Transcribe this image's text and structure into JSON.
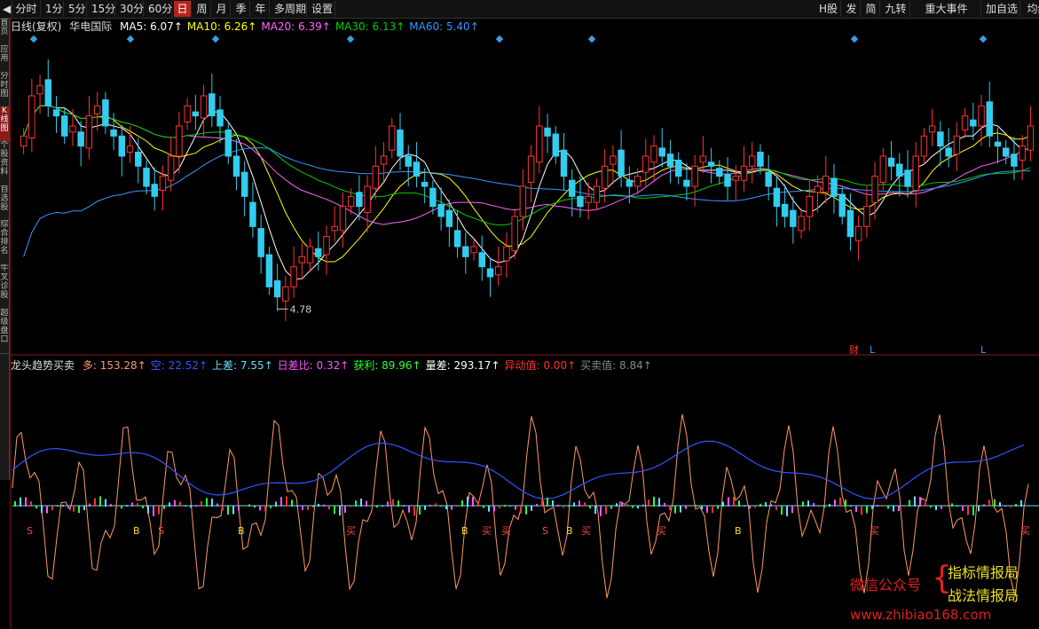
{
  "toolbar": {
    "left": [
      "分时",
      "1分",
      "5分",
      "15分",
      "30分",
      "60分",
      "日",
      "周",
      "月",
      "季",
      "年",
      "多周期",
      "设置"
    ],
    "active_index": 6,
    "right": [
      "H股",
      "发",
      "简",
      "九转",
      "重大事件",
      "加自选",
      "均线"
    ]
  },
  "side_tabs": [
    "首页",
    "应用",
    "分时图",
    "K线图",
    "个股资料",
    "自选股",
    "综合排名",
    "牛叉诊股",
    "超级盘口"
  ],
  "side_active": 3,
  "main": {
    "period_label": "日线(复权)",
    "stock_name": "华电国际",
    "ma": [
      {
        "label": "MA5: 6.07",
        "color": "#ffffff"
      },
      {
        "label": "MA10: 6.26",
        "color": "#ffff00"
      },
      {
        "label": "MA20: 6.39",
        "color": "#ff66ff"
      },
      {
        "label": "MA30: 6.13",
        "color": "#00cc00"
      },
      {
        "label": "MA60: 5.40",
        "color": "#3399ff"
      }
    ],
    "low_price_label": "4.78",
    "markers": [
      "财",
      "L",
      "L"
    ]
  },
  "indicator": {
    "name": "龙头趋势买卖",
    "values": [
      {
        "label": "多: 153.28",
        "color": "#ff9966"
      },
      {
        "label": "空: 22.52",
        "color": "#3355ff"
      },
      {
        "label": "上差: 7.55",
        "color": "#66ddff"
      },
      {
        "label": "日差比: 0.32",
        "color": "#ff55ff"
      },
      {
        "label": "获利: 89.96",
        "color": "#33ff33"
      },
      {
        "label": "量差: 293.17",
        "color": "#ffffff"
      },
      {
        "label": "异动值: 0.00",
        "color": "#ff3333"
      },
      {
        "label": "买卖值: 8.84",
        "color": "#888888"
      }
    ],
    "signals": [
      "S",
      "B",
      "S",
      "B",
      "买",
      "B",
      "买",
      "买",
      "S",
      "B",
      "买",
      "买",
      "B",
      "买",
      "买"
    ]
  },
  "watermark": {
    "left": "微信公众号",
    "right_line1": "指标情报局",
    "right_line2": "战法情报局",
    "url": "www.zhibiao168.com"
  },
  "chart_data": {
    "type": "candlestick",
    "stock": "华电国际",
    "period": "日线(复权)",
    "ma_latest": {
      "MA5": 6.07,
      "MA10": 6.26,
      "MA20": 6.39,
      "MA30": 6.13,
      "MA60": 5.4
    },
    "low": 4.78,
    "closes": [
      6.5,
      6.9,
      7.0,
      6.8,
      6.7,
      6.5,
      6.6,
      6.4,
      6.7,
      6.8,
      6.6,
      6.5,
      6.3,
      6.4,
      6.2,
      6.0,
      5.9,
      6.1,
      6.3,
      6.6,
      6.8,
      6.7,
      6.9,
      6.7,
      6.6,
      6.3,
      6.1,
      5.9,
      5.6,
      5.3,
      5.0,
      4.9,
      5.0,
      5.2,
      5.3,
      5.4,
      5.3,
      5.5,
      5.6,
      5.8,
      5.9,
      5.8,
      6.0,
      6.2,
      6.3,
      6.6,
      6.3,
      6.2,
      6.1,
      6.0,
      5.8,
      5.7,
      5.6,
      5.4,
      5.3,
      5.4,
      5.2,
      5.1,
      5.2,
      5.4,
      5.7,
      6.0,
      6.3,
      6.6,
      6.5,
      6.3,
      6.1,
      5.9,
      5.8,
      5.9,
      6.0,
      6.2,
      6.3,
      6.1,
      6.0,
      6.1,
      6.3,
      6.4,
      6.3,
      6.2,
      6.1,
      6.0,
      6.2,
      6.3,
      6.2,
      6.1,
      6.0,
      6.1,
      6.2,
      6.3,
      6.2,
      6.0,
      5.8,
      5.7,
      5.6,
      5.7,
      5.9,
      6.0,
      6.1,
      5.9,
      5.7,
      5.5,
      5.6,
      5.8,
      6.1,
      6.3,
      6.2,
      6.1,
      6.0,
      6.3,
      6.5,
      6.6,
      6.4,
      6.3,
      6.5,
      6.7,
      6.6,
      6.8,
      6.5,
      6.4,
      6.3,
      6.2,
      6.4,
      6.6
    ],
    "ylim": [
      4.5,
      7.5
    ]
  }
}
